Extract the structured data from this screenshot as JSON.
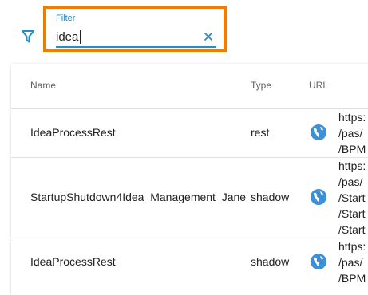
{
  "filter": {
    "label": "Filter",
    "value": "idea"
  },
  "table": {
    "headers": {
      "name": "Name",
      "type": "Type",
      "url": "URL"
    },
    "rows": [
      {
        "name": "IdeaProcessRest",
        "type": "rest",
        "url_lines": [
          "https:",
          "/pas/",
          "/BPM"
        ]
      },
      {
        "name": "StartupShutdown4Idea_Management_Jane",
        "type": "shadow",
        "url_lines": [
          "https:",
          "/pas/",
          "/Start",
          "/Start",
          "/Start"
        ]
      },
      {
        "name": "IdeaProcessRest",
        "type": "shadow",
        "url_lines": [
          "https:",
          "/pas/",
          "/BPM"
        ]
      }
    ]
  },
  "colors": {
    "accent": "#2a8cc6",
    "highlight": "#ef7d00",
    "globe": "#3d8fd6"
  },
  "icons": [
    "filter-icon",
    "clear-icon",
    "globe-icon"
  ]
}
